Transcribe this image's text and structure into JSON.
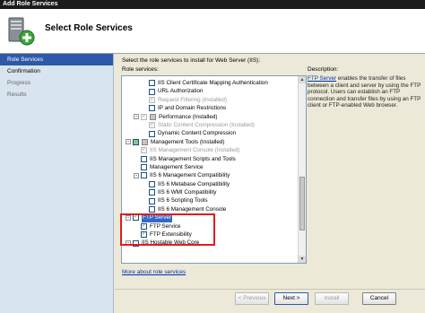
{
  "window": {
    "title": "Add Role Services"
  },
  "header": {
    "title": "Select Role Services",
    "icon": "server-add-icon"
  },
  "nav": {
    "items": [
      {
        "label": "Role Services",
        "state": "active"
      },
      {
        "label": "Confirmation",
        "state": "done"
      },
      {
        "label": "Progress",
        "state": "pending"
      },
      {
        "label": "Results",
        "state": "pending"
      }
    ]
  },
  "main": {
    "intro": "Select the role services to install for Web Server (IIS):",
    "role_services_label": "Role services:",
    "description_label": "Description:",
    "description_link": "FTP Server",
    "description_text": " enables the transfer of files between a client and server by using the FTP protocol. Users can establish an FTP connection and transfer files by using an FTP client or FTP-enabled Web browser.",
    "more_link": "More about role services",
    "tree": [
      {
        "label": "IIS Client Certificate Mapping Authentication",
        "indent": 3,
        "cb": "empty"
      },
      {
        "label": "URL Authorization",
        "indent": 3,
        "cb": "empty"
      },
      {
        "label": "Request Filtering  (Installed)",
        "indent": 3,
        "cb": "checked-dis",
        "dis": true
      },
      {
        "label": "IP and Domain Restrictions",
        "indent": 3,
        "cb": "empty"
      },
      {
        "label": "Performance  (Installed)",
        "indent": 2,
        "cb": "checked-dis",
        "exp": "-",
        "icon": true
      },
      {
        "label": "Static Content Compression  (Installed)",
        "indent": 3,
        "cb": "checked-dis",
        "dis": true
      },
      {
        "label": "Dynamic Content Compression",
        "indent": 3,
        "cb": "empty"
      },
      {
        "label": "Management Tools  (Installed)",
        "indent": 1,
        "cb": "partial",
        "exp": "-",
        "icon": true
      },
      {
        "label": "IIS Management Console  (Installed)",
        "indent": 2,
        "cb": "checked-dis",
        "dis": true
      },
      {
        "label": "IIS Management Scripts and Tools",
        "indent": 2,
        "cb": "empty"
      },
      {
        "label": "Management Service",
        "indent": 2,
        "cb": "empty"
      },
      {
        "label": "IIS 6 Management Compatibility",
        "indent": 2,
        "cb": "empty",
        "exp": "-"
      },
      {
        "label": "IIS 6 Metabase Compatibility",
        "indent": 3,
        "cb": "empty"
      },
      {
        "label": "IIS 6 WMI Compatibility",
        "indent": 3,
        "cb": "empty"
      },
      {
        "label": "IIS 6 Scripting Tools",
        "indent": 3,
        "cb": "empty"
      },
      {
        "label": "IIS 6 Management Console",
        "indent": 3,
        "cb": "empty"
      },
      {
        "label": "FTP Server",
        "indent": 1,
        "cb": "checked",
        "exp": "-",
        "selected": true
      },
      {
        "label": "FTP Service",
        "indent": 2,
        "cb": "checked"
      },
      {
        "label": "FTP Extensibility",
        "indent": 2,
        "cb": "checked"
      },
      {
        "label": "IIS Hostable Web Core",
        "indent": 1,
        "cb": "empty",
        "exp": "-"
      }
    ]
  },
  "buttons": {
    "previous": "< Previous",
    "next": "Next >",
    "install": "Install",
    "cancel": "Cancel"
  }
}
